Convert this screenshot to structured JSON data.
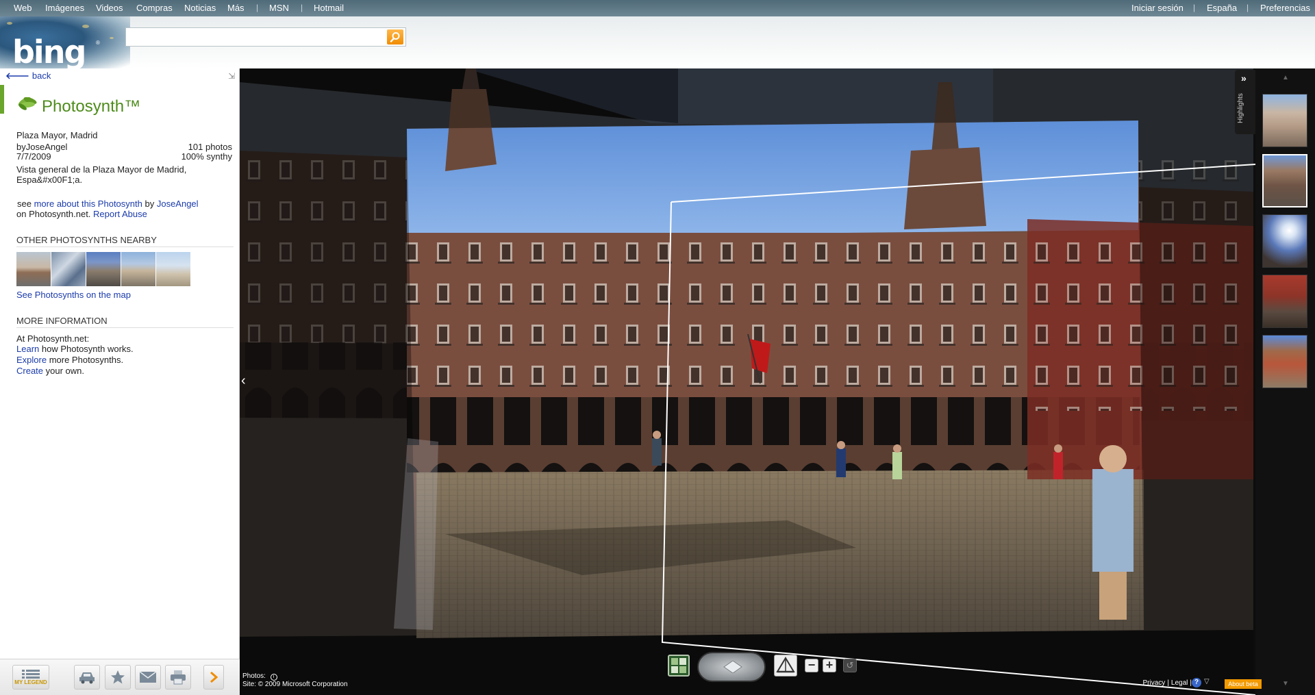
{
  "header": {
    "nav_left": [
      "Web",
      "Imágenes",
      "Videos",
      "Compras",
      "Noticias",
      "Más",
      "MSN",
      "Hotmail"
    ],
    "nav_right": [
      "Iniciar sesión",
      "España",
      "Preferencias"
    ],
    "logo_text": "bing",
    "search_value": ""
  },
  "left": {
    "back_label": "back",
    "title": "Photosynth™",
    "place": "Plaza Mayor, Madrid",
    "by_prefix": "by",
    "author": "JoseAngel",
    "photo_count": "101 photos",
    "date": "7/7/2009",
    "synthy": "100% synthy",
    "desc_line1": "Vista general de la Plaza Mayor de Madrid,",
    "desc_line2": "Espa&#x00F1;a.",
    "see_prefix": "see",
    "more_about_link": "more about this Photosynth",
    "by_word": "by",
    "author_link": "JoseAngel",
    "on_text": "on Photosynth.net.",
    "report_link": "Report Abuse",
    "nearby_heading": "OTHER PHOTOSYNTHS NEARBY",
    "see_map_link": "See Photosynths on the map",
    "more_info_heading": "MORE INFORMATION",
    "at_site": "At Photosynth.net:",
    "learn_link": "Learn",
    "learn_rest": "how Photosynth works.",
    "explore_link": "Explore",
    "explore_rest": "more Photosynths.",
    "create_link": "Create",
    "create_rest": "your own.",
    "legend_label": "MY LEGEND"
  },
  "viewer": {
    "highlights_label": "Highlights",
    "photos_label": "Photos:",
    "site_credit": "Site: © 2009 Microsoft Corporation",
    "footer": {
      "privacy": "Privacy",
      "legal": "Legal",
      "about_beta": "About beta"
    }
  },
  "colors": {
    "accent_green": "#4d8c1a",
    "link_blue": "#1b3bab",
    "search_orange": "#f08c00"
  }
}
